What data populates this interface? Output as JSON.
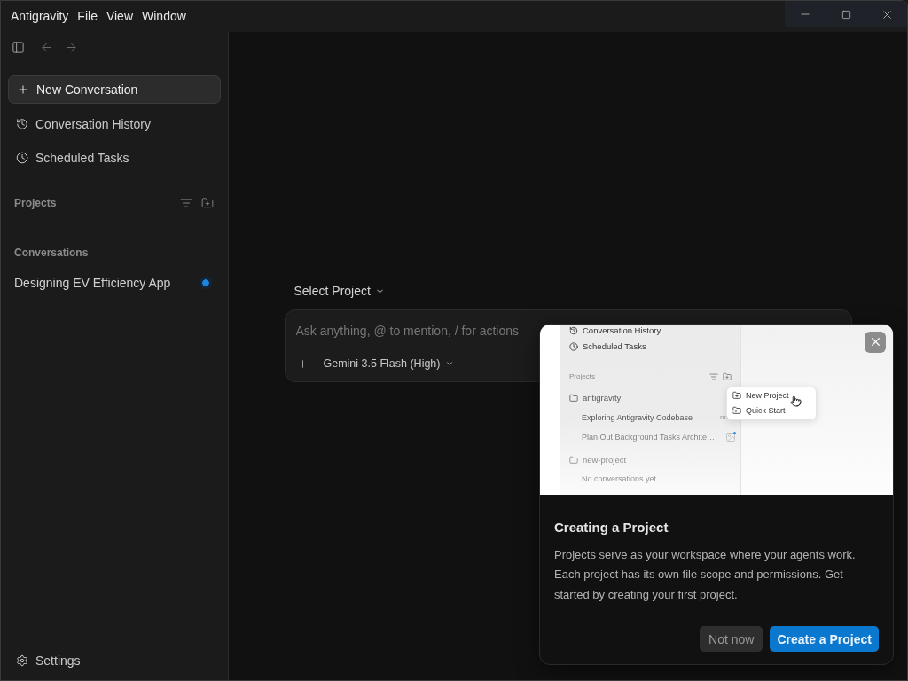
{
  "menu_bar": {
    "items": [
      "Antigravity",
      "File",
      "View",
      "Window"
    ]
  },
  "sidebar": {
    "new_conversation": "New Conversation",
    "links": [
      "Conversation History",
      "Scheduled Tasks"
    ],
    "projects_heading": "Projects",
    "conversations_heading": "Conversations",
    "conversations": [
      {
        "title": "Designing EV Efficiency App",
        "unread": true
      }
    ],
    "settings": "Settings"
  },
  "main": {
    "project_selector": "Select Project",
    "composer": {
      "placeholder": "Ask anything, @ to mention, / for actions",
      "model": "Gemini 3.5 Flash (High)"
    }
  },
  "tour_card": {
    "preview": {
      "links": [
        "Conversation History",
        "Scheduled Tasks"
      ],
      "projects_heading": "Projects",
      "projects": [
        {
          "name": "antigravity",
          "conversations": [
            {
              "title": "Exploring Antigravity Codebase",
              "meta": "no",
              "unread": false
            },
            {
              "title": "Plan Out Background Tasks Archite…",
              "unread": true
            }
          ]
        },
        {
          "name": "new-project",
          "empty_text": "No conversations yet"
        }
      ],
      "menu": [
        "New Project",
        "Quick Start"
      ]
    },
    "title": "Creating a Project",
    "body": "Projects serve as your workspace where your agents work. Each project has its own file scope and permissions. Get started by creating your first project.",
    "buttons": [
      {
        "label": "Not now",
        "kind": "secondary"
      },
      {
        "label": "Create a Project",
        "kind": "primary"
      }
    ]
  }
}
